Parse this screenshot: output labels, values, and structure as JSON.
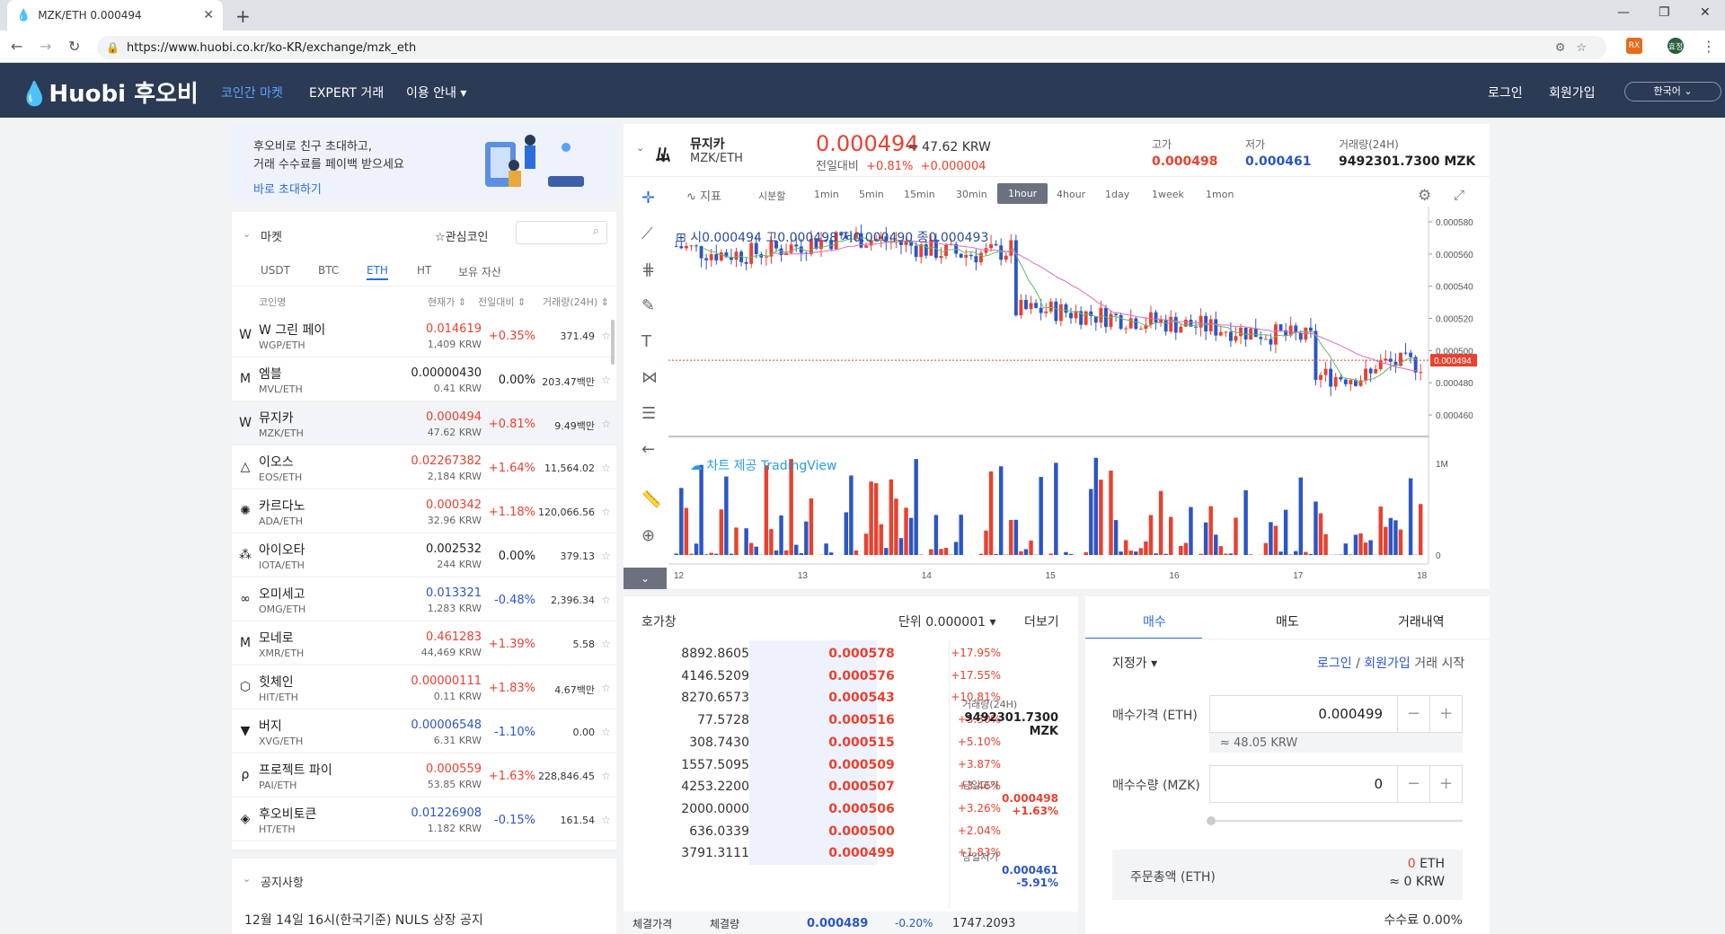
{
  "browser": {
    "tab_title": "MZK/ETH 0.000494",
    "url": "https://www.huobi.co.kr/ko-KR/exchange/mzk_eth"
  },
  "header": {
    "logo_en": "Huobi",
    "logo_ko": "후오비",
    "nav": [
      "코인간 마켓",
      "EXPERT 거래",
      "이용 안내"
    ],
    "login": "로그인",
    "signup": "회원가입",
    "lang": "한국어"
  },
  "promo": {
    "line1": "후오비로 친구 초대하고,",
    "line2": "거래 수수료를 페이백 받으세요",
    "link": "바로 초대하기"
  },
  "market": {
    "title": "마켓",
    "favorites": "관심코인",
    "tabs": [
      "USDT",
      "BTC",
      "ETH",
      "HT",
      "보유 자산"
    ],
    "active_tab": "ETH",
    "columns": [
      "코인명",
      "현재가",
      "전일대비",
      "거래량(24H)"
    ],
    "rows": [
      {
        "name": "W 그린 페이",
        "pair": "WGP/ETH",
        "price": "0.014619",
        "krw": "1,409 KRW",
        "change": "+0.35%",
        "vol": "371.49",
        "dir": "up",
        "icon": "W"
      },
      {
        "name": "엠블",
        "pair": "MVL/ETH",
        "price": "0.00000430",
        "krw": "0.41 KRW",
        "change": "0.00%",
        "vol": "203.47백만",
        "dir": "neu",
        "icon": "M"
      },
      {
        "name": "뮤지카",
        "pair": "MZK/ETH",
        "price": "0.000494",
        "krw": "47.62 KRW",
        "change": "+0.81%",
        "vol": "9.49백만",
        "dir": "up",
        "icon": "W"
      },
      {
        "name": "이오스",
        "pair": "EOS/ETH",
        "price": "0.02267382",
        "krw": "2,184 KRW",
        "change": "+1.64%",
        "vol": "11,564.02",
        "dir": "up",
        "icon": "△"
      },
      {
        "name": "카르다노",
        "pair": "ADA/ETH",
        "price": "0.000342",
        "krw": "32.96 KRW",
        "change": "+1.18%",
        "vol": "120,066.56",
        "dir": "up",
        "icon": "✺"
      },
      {
        "name": "아이오타",
        "pair": "IOTA/ETH",
        "price": "0.002532",
        "krw": "244 KRW",
        "change": "0.00%",
        "vol": "379.13",
        "dir": "neu",
        "icon": "⁂"
      },
      {
        "name": "오미세고",
        "pair": "OMG/ETH",
        "price": "0.013321",
        "krw": "1,283 KRW",
        "change": "-0.48%",
        "vol": "2,396.34",
        "dir": "dn",
        "icon": "∞"
      },
      {
        "name": "모네로",
        "pair": "XMR/ETH",
        "price": "0.461283",
        "krw": "44,469 KRW",
        "change": "+1.39%",
        "vol": "5.58",
        "dir": "up",
        "icon": "M"
      },
      {
        "name": "힛체인",
        "pair": "HIT/ETH",
        "price": "0.00000111",
        "krw": "0.11 KRW",
        "change": "+1.83%",
        "vol": "4.67백만",
        "dir": "up",
        "icon": "⬡"
      },
      {
        "name": "버지",
        "pair": "XVG/ETH",
        "price": "0.00006548",
        "krw": "6.31 KRW",
        "change": "-1.10%",
        "vol": "0.00",
        "dir": "dn",
        "icon": "▼"
      },
      {
        "name": "프로젝트 파이",
        "pair": "PAI/ETH",
        "price": "0.000559",
        "krw": "53.85 KRW",
        "change": "+1.63%",
        "vol": "228,846.45",
        "dir": "up",
        "icon": "ρ"
      },
      {
        "name": "후오비토큰",
        "pair": "HT/ETH",
        "price": "0.01226908",
        "krw": "1.182 KRW",
        "change": "-0.15%",
        "vol": "161.54",
        "dir": "dn",
        "icon": "◈"
      }
    ]
  },
  "notice": {
    "title": "공지사항",
    "item": "12월 14일 16시(한국기준) NULS 상장 공지"
  },
  "ticker": {
    "name": "뮤지카",
    "pair": "MZK/ETH",
    "price": "0.000494",
    "approx": "≈ 47.62 KRW",
    "change_label": "전일대비",
    "change_pct": "+0.81%",
    "change_abs": "+0.000004",
    "high_label": "고가",
    "high": "0.000498",
    "low_label": "저가",
    "low": "0.000461",
    "vol_label": "거래량(24H)",
    "vol": "9492301.7300 MZK"
  },
  "chart": {
    "indicator": "지표",
    "timeframes": [
      "시분할",
      "1min",
      "5min",
      "15min",
      "30min",
      "1hour",
      "4hour",
      "1day",
      "1week",
      "1mon"
    ],
    "active": "1hour",
    "ohlc": {
      "o_label": "시",
      "o": "0.000494",
      "h_label": "고",
      "h": "0.000498",
      "l_label": "저",
      "l": "0.000490",
      "c_label": "종",
      "c": "0.000493"
    },
    "watermark": "차트 제공 TradingView",
    "price_ticks": [
      "0.000580",
      "0.000560",
      "0.000540",
      "0.000520",
      "0.000500",
      "0.000480",
      "0.000460"
    ],
    "last_price": "0.000494",
    "vol_ticks": [
      "1M",
      "0"
    ],
    "x_ticks": [
      "12",
      "13",
      "14",
      "15",
      "16",
      "17",
      "18"
    ]
  },
  "chart_data": {
    "type": "candlestick",
    "ylim": [
      0.00045,
      0.000585
    ],
    "last": 0.000494
  },
  "orderbook": {
    "title": "호가창",
    "unit_label": "단위",
    "unit": "0.000001",
    "more": "더보기",
    "asks": [
      {
        "q": "8892.8605",
        "p": "0.000578",
        "c": "+17.95%"
      },
      {
        "q": "4146.5209",
        "p": "0.000576",
        "c": "+17.55%"
      },
      {
        "q": "8270.6573",
        "p": "0.000543",
        "c": "+10.81%"
      },
      {
        "q": "77.5728",
        "p": "0.000516",
        "c": "+5.30%"
      },
      {
        "q": "308.7430",
        "p": "0.000515",
        "c": "+5.10%"
      },
      {
        "q": "1557.5095",
        "p": "0.000509",
        "c": "+3.87%"
      },
      {
        "q": "4253.2200",
        "p": "0.000507",
        "c": "+3.46%"
      },
      {
        "q": "2000.0000",
        "p": "0.000506",
        "c": "+3.26%"
      },
      {
        "q": "636.0339",
        "p": "0.000500",
        "c": "+2.04%"
      },
      {
        "q": "3791.3111",
        "p": "0.000499",
        "c": "+1.83%"
      }
    ],
    "side": {
      "vol_label": "거래량(24H)",
      "vol": "9492301.7300",
      "vol_unit": "MZK",
      "high_label": "당일고가",
      "high": "0.000498",
      "high_pct": "+1.63%",
      "low_label": "당일저가",
      "low": "0.000461",
      "low_pct": "-5.91%"
    },
    "footer": {
      "price_label": "체결가격",
      "qty_label": "체결량",
      "price": "0.000489",
      "pct": "-0.20%",
      "qty": "1747.2093"
    }
  },
  "trade": {
    "tabs": [
      "매수",
      "매도",
      "거래내역"
    ],
    "order_type": "지정가",
    "login": "로그인",
    "sep": "/",
    "signup": "회원가입",
    "start": "거래 시작",
    "price_label": "매수가격 (ETH)",
    "price": "0.000499",
    "price_krw": "≈ 48.05 KRW",
    "qty_label": "매수수량 (MZK)",
    "qty": "0",
    "total_label": "주문총액 (ETH)",
    "total_eth": "0",
    "eth": "ETH",
    "total_krw": "≈ 0",
    "krw": "KRW",
    "fee": "수수료 0.00%"
  }
}
